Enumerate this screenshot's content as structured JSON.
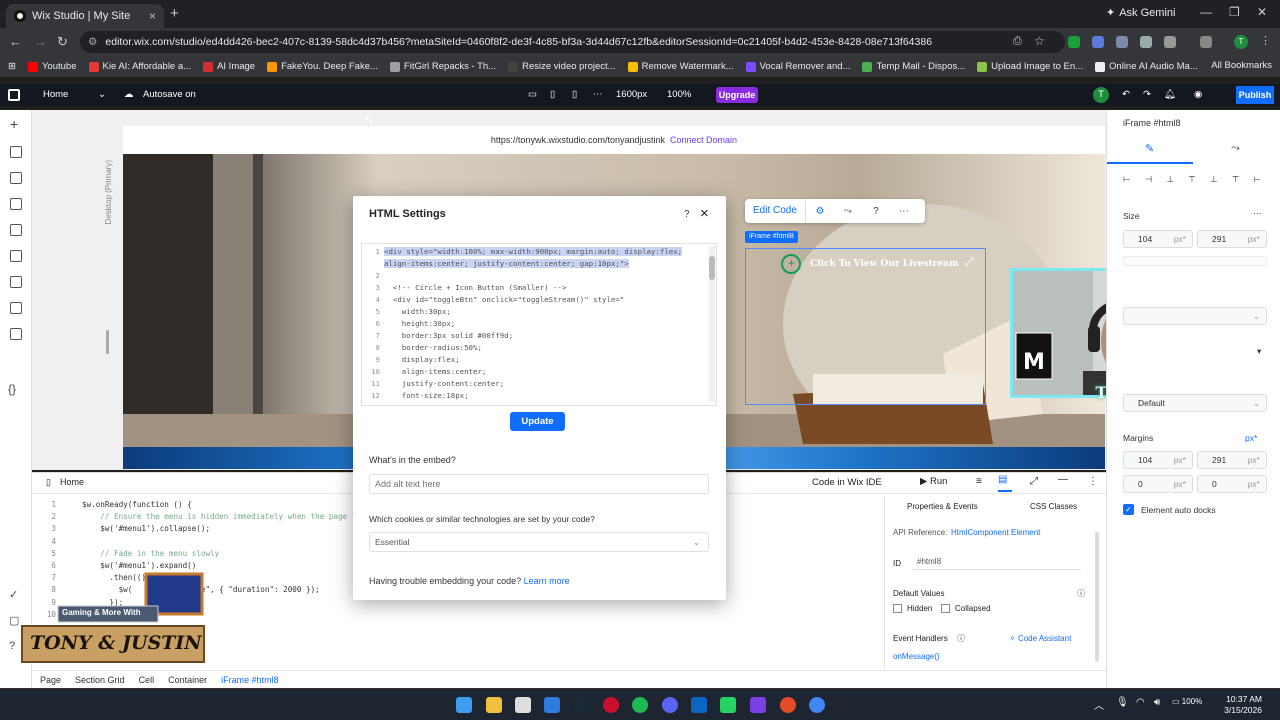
{
  "browser": {
    "tab_title": "Wix Studio | My Site",
    "new_tab_icon": "+",
    "gemini_label": "Ask Gemini",
    "url": "editor.wix.com/studio/ed4dd426-bec2-407c-8139-58dc4d37b456?metaSiteId=0460f8f2-de3f-4c85-bf3a-3d44d67c12fb&editorSessionId=0c21405f-b4d2-453e-8428-08e713f64386",
    "bookmarks": [
      {
        "label": "Youtube",
        "color": "#ff0000"
      },
      {
        "label": "Kie AI: Affordable a...",
        "color": "#e53935"
      },
      {
        "label": "AI Image",
        "color": "#d32f2f"
      },
      {
        "label": "FakeYou. Deep Fake...",
        "color": "#ff9800"
      },
      {
        "label": "FitGirl Repacks - Th...",
        "color": "#9e9e9e"
      },
      {
        "label": "Resize video project...",
        "color": "#424242"
      },
      {
        "label": "Remove Watermark...",
        "color": "#fbbc04"
      },
      {
        "label": "Vocal Remover and...",
        "color": "#7c4dff"
      },
      {
        "label": "Temp Mail - Dispos...",
        "color": "#4caf50"
      },
      {
        "label": "Upload Image to En...",
        "color": "#8bc34a"
      },
      {
        "label": "Online AI Audio Ma...",
        "color": "#eeeeee"
      }
    ],
    "all_bookmarks": "All Bookmarks"
  },
  "wix_topbar": {
    "page": "Home",
    "autosave": "Autosave on",
    "breakpoint": "1600px",
    "zoom": "100%",
    "upgrade": "Upgrade",
    "publish": "Publish",
    "avatar": "T"
  },
  "canvas": {
    "site_url": "https://tonywk.wixstudio.com/tonyandjustink",
    "connect_domain": "Connect Domain",
    "desktop_label": "Desktop (Primary)",
    "iframe_tag": "iFrame #html8",
    "livestream_text": "Click To View Our Livestream",
    "edit_code": "Edit Code",
    "webcam_name": "Tony K"
  },
  "modal": {
    "title": "HTML Settings",
    "help": "?",
    "close": "×",
    "code_lines": [
      {
        "n": "1",
        "text": "<div style=\"width:100%; max-width:900px; margin:auto; display:flex;"
      },
      {
        "n": "",
        "text": "align-items:center; justify-content:center; gap:10px;\">"
      },
      {
        "n": "2",
        "text": ""
      },
      {
        "n": "3",
        "text": "  <!-- Circle + Icon Button (Smaller) -->"
      },
      {
        "n": "4",
        "text": "  <div id=\"toggleBtn\" onclick=\"toggleStream()\" style=\""
      },
      {
        "n": "5",
        "text": "    width:30px;"
      },
      {
        "n": "6",
        "text": "    height:30px;"
      },
      {
        "n": "7",
        "text": "    border:3px solid #00ff9d;"
      },
      {
        "n": "8",
        "text": "    border-radius:50%;"
      },
      {
        "n": "9",
        "text": "    display:flex;"
      },
      {
        "n": "10",
        "text": "    align-items:center;"
      },
      {
        "n": "11",
        "text": "    justify-content:center;"
      },
      {
        "n": "12",
        "text": "    font-size:18px;"
      }
    ],
    "update": "Update",
    "embed_label": "What's in the embed?",
    "alt_placeholder": "Add alt text here",
    "cookies_label": "Which cookies or similar technologies are set by your code?",
    "cookies_value": "Essential",
    "trouble_text": "Having trouble embedding your code?",
    "learn_more": "Learn more"
  },
  "right_panel": {
    "title": "iFrame #html8",
    "size_label": "Size",
    "width": "104",
    "height": "291",
    "unit": "px*",
    "margins_label": "Margins",
    "margin_unit": "px*",
    "margin_top": "104",
    "margin_right": "291",
    "margin_bottom": "0",
    "margin_left": "0",
    "auto_docks": "Element auto docks",
    "layout_value": "Default"
  },
  "code_panel": {
    "file_tab": "Home",
    "code_in_ide": "Code in Wix IDE",
    "run": "Run",
    "lines": [
      {
        "n": "1",
        "text": "$w.onReady(function () {"
      },
      {
        "n": "2",
        "text": "    // Ensure the menu is hidden immediately when the page lo"
      },
      {
        "n": "3",
        "text": "    $w('#menu1').collapse();"
      },
      {
        "n": "4",
        "text": ""
      },
      {
        "n": "5",
        "text": "    // Fade in the menu slowly"
      },
      {
        "n": "6",
        "text": "    $w('#menu1').expand()"
      },
      {
        "n": "7",
        "text": "      .then(() => {"
      },
      {
        "n": "8",
        "text": "        $w(         w(\"fade\", { \"duration\": 2000 });"
      },
      {
        "n": "9",
        "text": "      });"
      },
      {
        "n": "10",
        "text": "});"
      }
    ],
    "props_tab": "Properties & Events",
    "css_tab": "CSS Classes",
    "api_ref_label": "API Reference:",
    "api_ref_link": "HtmlComponent Element",
    "id_label": "ID",
    "id_value": "#html8",
    "default_values": "Default Values",
    "hidden": "Hidden",
    "collapsed": "Collapsed",
    "event_handlers": "Event Handlers",
    "code_assistant": "Code Assistant",
    "on_message": "onMessage()"
  },
  "logo": {
    "small_text": "Gaming & More With",
    "big_text": "TONY & JUSTIN"
  },
  "breadcrumbs": [
    "Page",
    "Section Grid",
    "Cell",
    "Container",
    "iFrame #html8"
  ],
  "taskbar": {
    "battery": "100%",
    "time": "10:37 AM",
    "date": "3/15/2026"
  }
}
